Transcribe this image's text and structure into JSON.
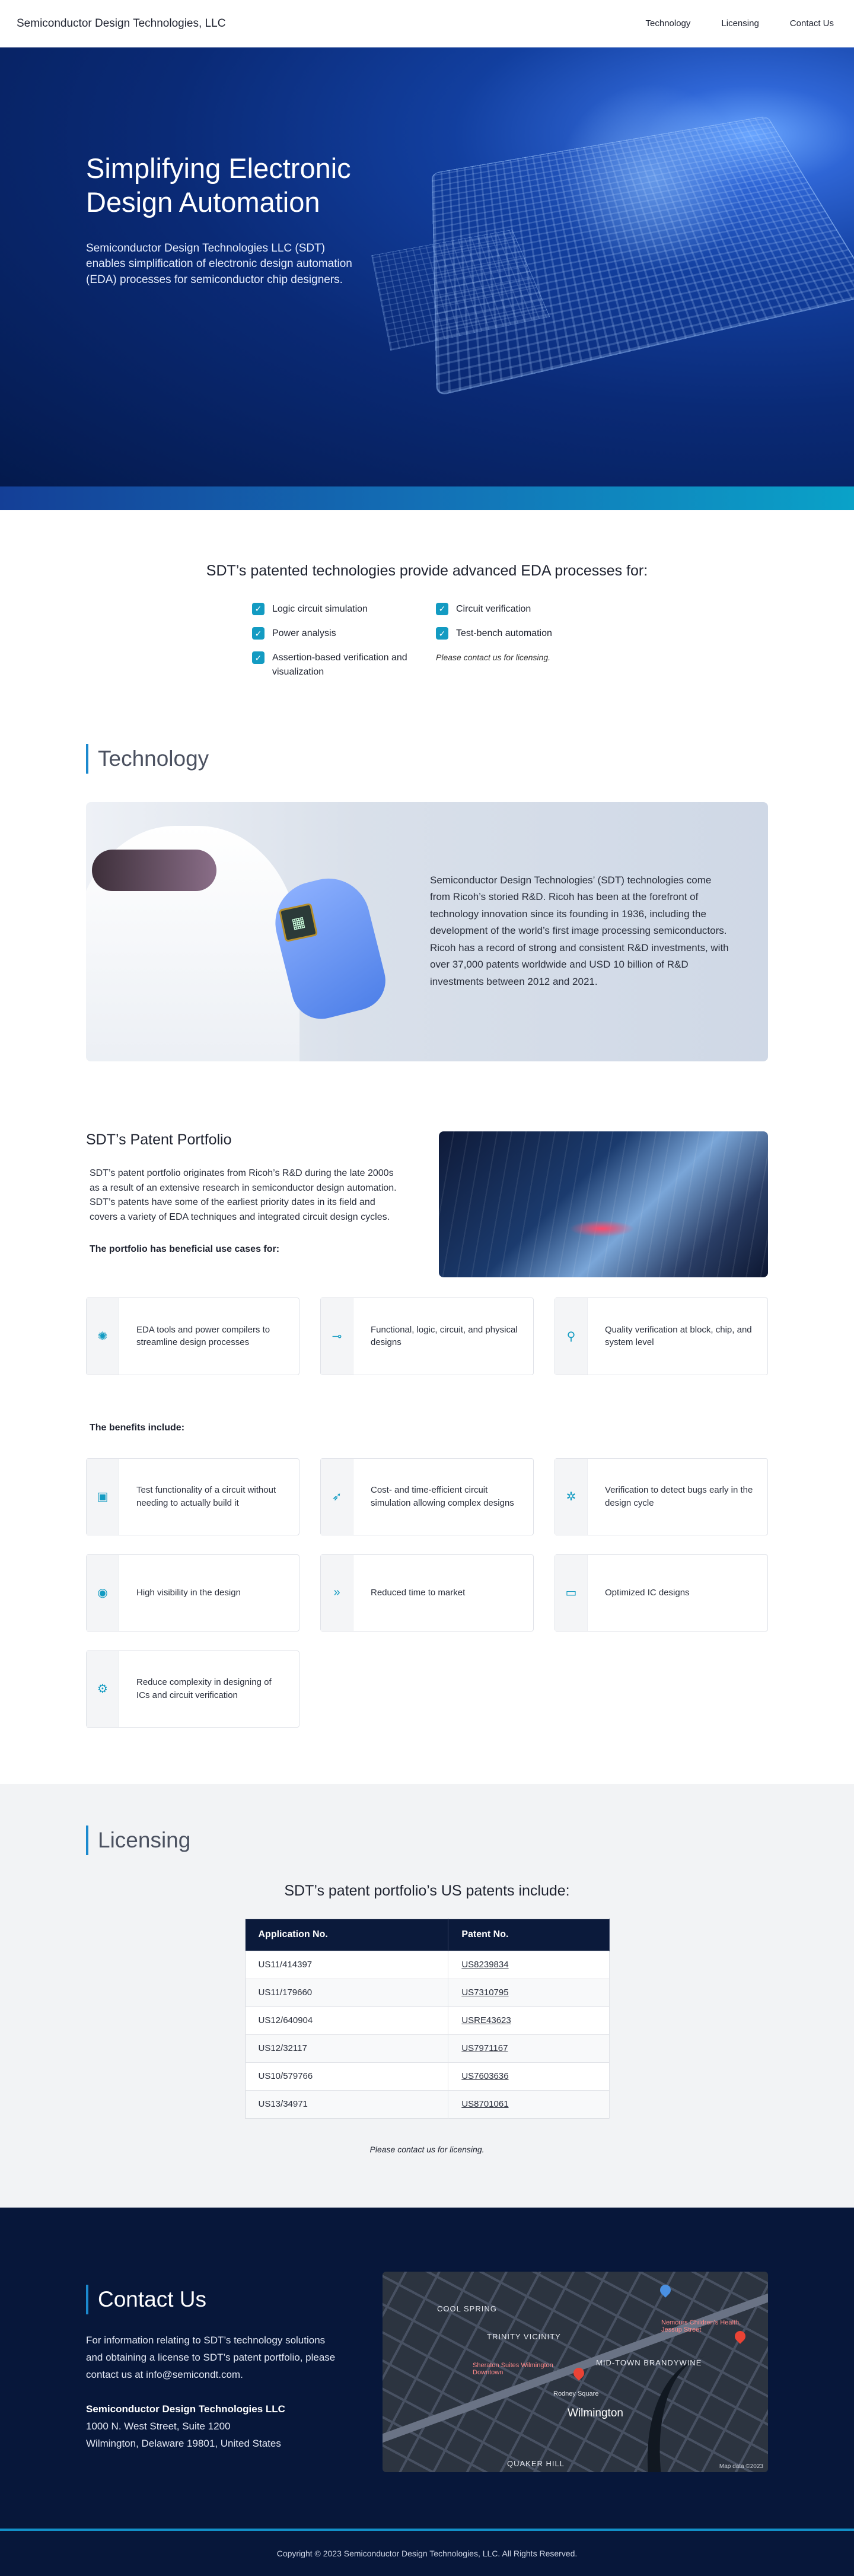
{
  "nav": {
    "brand": "Semiconductor Design Technologies, LLC",
    "links": [
      "Technology",
      "Licensing",
      "Contact Us"
    ]
  },
  "hero": {
    "title": "Simplifying Electronic Design Automation",
    "description": "Semiconductor Design Technologies LLC (SDT) enables simplification of electronic design automation (EDA) processes for semiconductor chip designers."
  },
  "features": {
    "heading": "SDT’s patented technologies provide advanced EDA processes for:",
    "left": [
      "Logic circuit simulation",
      "Power analysis",
      "Assertion-based verification and visualization"
    ],
    "right": [
      "Circuit verification",
      "Test-bench automation"
    ],
    "note": "Please contact us for licensing."
  },
  "technology": {
    "heading": "Technology",
    "body": "Semiconductor Design Technologies’ (SDT) technologies come from Ricoh’s storied R&D. Ricoh has been at the forefront of technology innovation since its founding in 1936, including the development of the world’s first image processing semiconductors. Ricoh has a record of strong and consistent R&D investments, with over 37,000 patents worldwide and USD 10 billion of R&D investments between 2012 and 2021."
  },
  "portfolio": {
    "heading": "SDT’s Patent Portfolio",
    "body": "SDT’s patent portfolio originates from Ricoh’s R&D during the late 2000s as a result of an extensive research in semiconductor design automation. SDT’s patents have some of the earliest priority dates in its field and covers a variety of EDA techniques and integrated circuit design cycles.",
    "use_cases_title": "The portfolio has beneficial use cases for:",
    "use_cases": [
      {
        "icon": "sparkle-icon",
        "label": "EDA tools and power compilers to streamline design processes"
      },
      {
        "icon": "key-icon",
        "label": "Functional, logic, circuit, and physical designs"
      },
      {
        "icon": "microscope-icon",
        "label": "Quality verification at block, chip, and system level"
      }
    ],
    "benefits_title": "The benefits include:",
    "benefits": [
      {
        "icon": "calendar-icon",
        "label": "Test functionality of a circuit without needing to actually build it"
      },
      {
        "icon": "rocket-icon",
        "label": "Cost- and time-efficient circuit simulation allowing complex designs"
      },
      {
        "icon": "bug-icon",
        "label": "Verification to detect bugs early in the design cycle"
      },
      {
        "icon": "eye-icon",
        "label": "High visibility in the design"
      },
      {
        "icon": "fast-forward-icon",
        "label": "Reduced time to market"
      },
      {
        "icon": "monitor-icon",
        "label": "Optimized IC designs"
      },
      {
        "icon": "settings-icon",
        "label": "Reduce complexity in designing of ICs and circuit verification"
      }
    ]
  },
  "licensing": {
    "heading": "Licensing",
    "subheading": "SDT’s patent portfolio’s US patents include:",
    "columns": [
      "Application No.",
      "Patent No."
    ],
    "rows": [
      [
        "US11/414397",
        "US8239834"
      ],
      [
        "US11/179660",
        "US7310795"
      ],
      [
        "US12/640904",
        "USRE43623"
      ],
      [
        "US12/32117",
        "US7971167"
      ],
      [
        "US10/579766",
        "US7603636"
      ],
      [
        "US13/34971",
        "US8701061"
      ]
    ],
    "note": "Please contact us for licensing."
  },
  "contact": {
    "heading": "Contact Us",
    "body": "For information relating to SDT’s technology solutions and obtaining a license to SDT’s patent portfolio, please contact us at info@semicondt.com.",
    "company": "Semiconductor Design Technologies LLC",
    "street": "1000 N. West Street, Suite 1200",
    "city": "Wilmington, Delaware 19801, United States",
    "map": {
      "labels": [
        "COOL SPRING",
        "TRINITY VICINITY",
        "MID-TOWN BRANDYWINE",
        "Wilmington",
        "QUAKER HILL",
        "Rodney Square",
        "Nemours Children's Health, Jessup Street",
        "Sheraton Suites Wilmington Downtown"
      ],
      "credit": "Map data ©2023"
    }
  },
  "footer": {
    "copyright": "Copyright © 2023 Semiconductor Design Technologies, LLC. All Rights Reserved."
  }
}
